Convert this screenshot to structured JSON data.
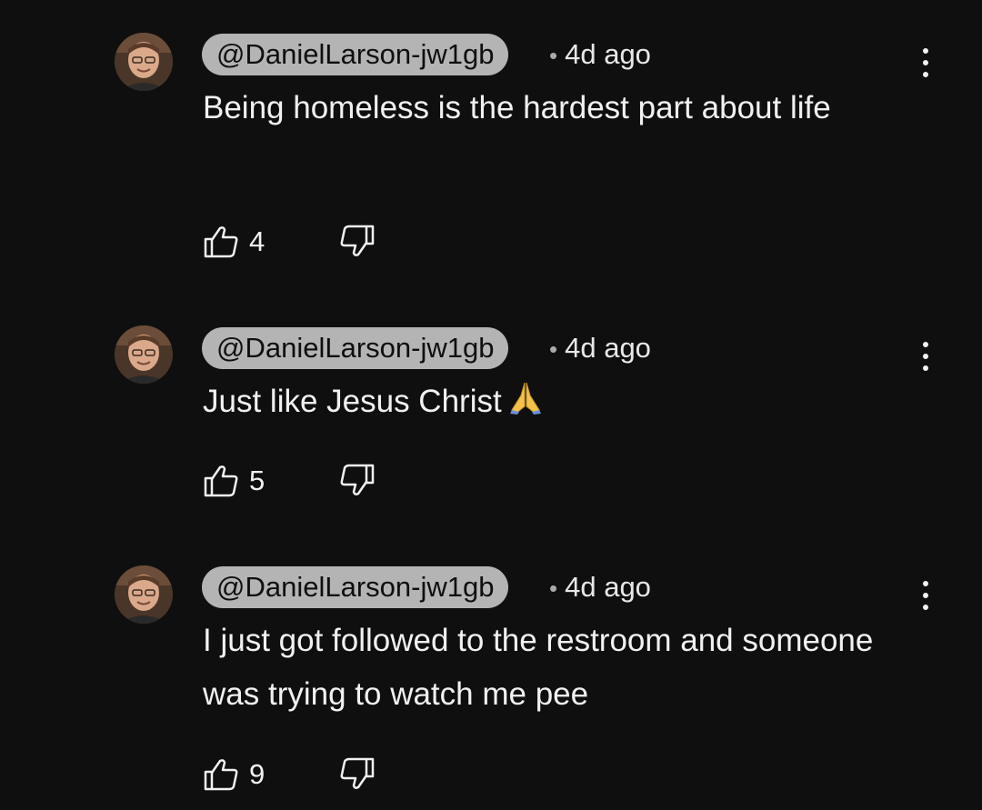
{
  "comments": [
    {
      "handle": "@DanielLarson-jw1gb",
      "age": "4d ago",
      "text": "Being homeless is the hardest part about life",
      "likes": "4",
      "emoji": ""
    },
    {
      "handle": "@DanielLarson-jw1gb",
      "age": "4d ago",
      "text": "Just like Jesus Christ",
      "likes": "5",
      "emoji": "folded-hands"
    },
    {
      "handle": "@DanielLarson-jw1gb",
      "age": "4d ago",
      "text": "I just got followed to the restroom and someone was trying to watch me pee",
      "likes": "9",
      "emoji": ""
    }
  ],
  "colors": {
    "background": "#0f0f0f",
    "text": "#f1f1f1",
    "pill": "#d9d9d9"
  },
  "icons": [
    "avatar",
    "more-vert-icon",
    "thumb-up-icon",
    "thumb-down-icon",
    "folded-hands-emoji"
  ]
}
